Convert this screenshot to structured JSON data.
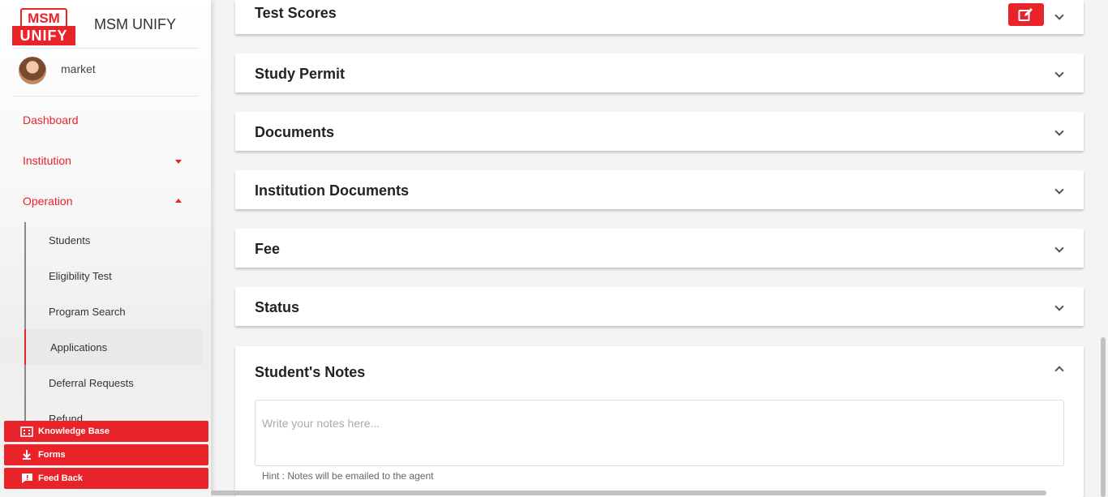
{
  "brand": {
    "logo_top": "MSM",
    "logo_bottom": "UNIFY",
    "app_title": "MSM UNIFY",
    "accent": "#e8232a"
  },
  "user": {
    "name": "market"
  },
  "nav": {
    "dashboard": "Dashboard",
    "institution": "Institution",
    "operation": "Operation",
    "sub_items": [
      "Students",
      "Eligibility Test",
      "Program Search",
      "Applications",
      "Deferral Requests",
      "Refund"
    ],
    "active_sub": "Applications"
  },
  "quick_links": [
    {
      "label": "Knowledge Base",
      "icon": "building-icon"
    },
    {
      "label": "Forms",
      "icon": "download-icon"
    },
    {
      "label": "Feed Back",
      "icon": "feedback-icon"
    }
  ],
  "sections": [
    {
      "title": "Test Scores",
      "expanded": false,
      "editable": true
    },
    {
      "title": "Study Permit",
      "expanded": false
    },
    {
      "title": "Documents",
      "expanded": false
    },
    {
      "title": "Institution Documents",
      "expanded": false
    },
    {
      "title": "Fee",
      "expanded": false
    },
    {
      "title": "Status",
      "expanded": false
    }
  ],
  "notes": {
    "title": "Student's Notes",
    "placeholder": "Write your notes here...",
    "hint": "Hint : Notes will be emailed to the agent"
  }
}
